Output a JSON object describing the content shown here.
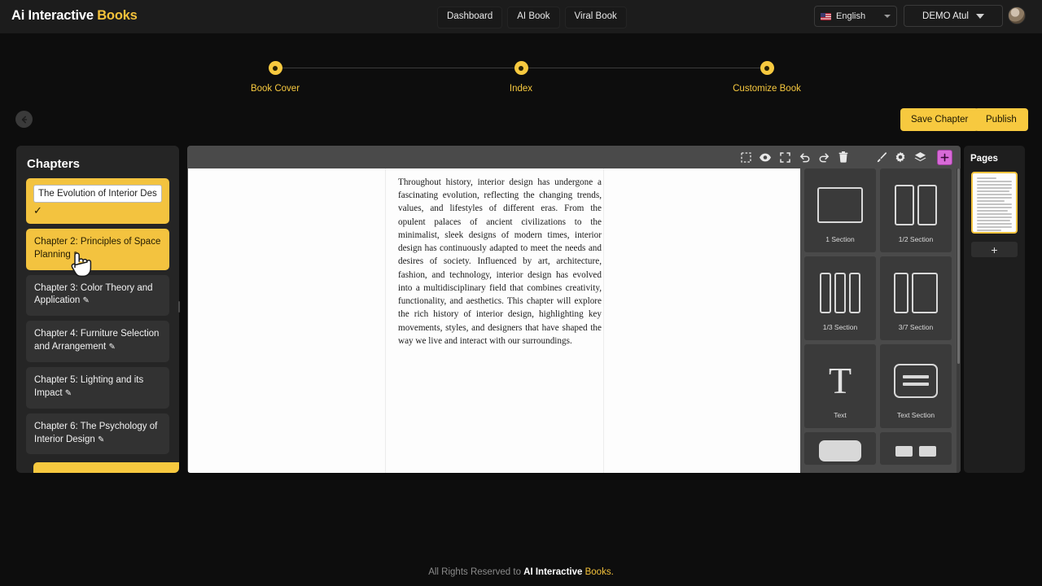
{
  "brand": {
    "text1": "Ai Interactive",
    "text2": "Books"
  },
  "nav": {
    "items": [
      {
        "label": "Dashboard"
      },
      {
        "label": "AI Book"
      },
      {
        "label": "Viral Book"
      }
    ],
    "language": {
      "label": "English",
      "icon": "us-flag-icon"
    },
    "user": {
      "label": "DEMO Atul"
    }
  },
  "stepper": {
    "steps": [
      {
        "label": "Book Cover"
      },
      {
        "label": "Index"
      },
      {
        "label": "Customize Book"
      }
    ],
    "active_color": "#f7c93f"
  },
  "actions": {
    "back_icon": "back-arrow-icon",
    "save_label": "Save Chapter",
    "publish_label": "Publish"
  },
  "chapters": {
    "title": "Chapters",
    "items": [
      {
        "label": "The Evolution of Interior Des",
        "state": "editing",
        "confirm_icon": "check-icon"
      },
      {
        "label": "Chapter 2: Principles of Space Planning",
        "state": "active"
      },
      {
        "label": "Chapter 3: Color Theory and Application",
        "state": "default"
      },
      {
        "label": "Chapter 4: Furniture Selection and Arrangement",
        "state": "default"
      },
      {
        "label": "Chapter 5: Lighting and its Impact",
        "state": "default"
      },
      {
        "label": "Chapter 6: The Psychology of Interior Design",
        "state": "default"
      }
    ],
    "add_label": ""
  },
  "toolbar": {
    "tools": [
      {
        "name": "select-icon"
      },
      {
        "name": "eye-icon"
      },
      {
        "name": "fullscreen-icon"
      },
      {
        "name": "undo-icon"
      },
      {
        "name": "redo-icon"
      },
      {
        "name": "trash-icon"
      },
      {
        "name": "brush-icon"
      },
      {
        "name": "gear-icon"
      },
      {
        "name": "layers-icon"
      }
    ],
    "add_icon": "plus-icon",
    "add_color": "#d86ad8"
  },
  "document": {
    "body": "Throughout history, interior design has undergone a fascinating evolution, reflecting the changing trends, values, and lifestyles of different eras. From the opulent palaces of ancient civilizations to the minimalist, sleek designs of modern times, interior design has continuously adapted to meet the needs and desires of society. Influenced by art, architecture, fashion, and technology, interior design has evolved into a multidisciplinary field that combines creativity, functionality, and aesthetics. This chapter will explore the rich history of interior design, highlighting key movements, styles, and designers that have shaped the way we live and interact with our surroundings."
  },
  "palette": {
    "cards": [
      {
        "label": "1 Section",
        "art": "one"
      },
      {
        "label": "1/2 Section",
        "art": "half"
      },
      {
        "label": "1/3 Section",
        "art": "third"
      },
      {
        "label": "3/7 Section",
        "art": "threeseven"
      },
      {
        "label": "Text",
        "art": "text"
      },
      {
        "label": "Text Section",
        "art": "textsection"
      },
      {
        "label": "",
        "art": "button"
      },
      {
        "label": "",
        "art": "pair"
      }
    ]
  },
  "pages": {
    "title": "Pages",
    "add_label": "+",
    "thumb_lines": 19
  },
  "footer": {
    "prefix": "All Rights Reserved to ",
    "brand1": "AI Interactive",
    "brand2": "Books."
  }
}
